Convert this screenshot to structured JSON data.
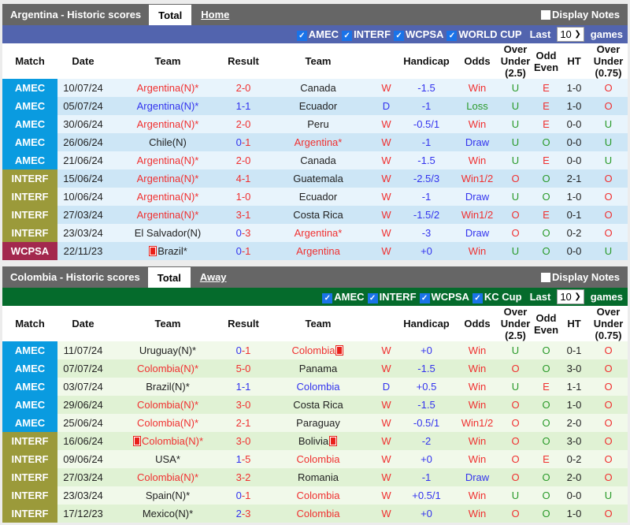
{
  "colors": {
    "argentina_filter": "#5264ae",
    "colombia_filter": "#056b2c",
    "AMEC": "#0a9be0",
    "INTERF": "#9b9a3a",
    "WCPSA": "#a3284e"
  },
  "columns": [
    "Match",
    "Date",
    "Team",
    "Result",
    "Team",
    "",
    "Handicap",
    "Odds",
    "Over Under (2.5)",
    "Odd Even",
    "HT",
    "Over Under (0.75)"
  ],
  "panels": [
    {
      "key": "arg",
      "title": "Argentina - Historic scores",
      "tab_active": "Total",
      "tab_link": "Home",
      "notes": "Display Notes",
      "filters": [
        "AMEC",
        "INTERF",
        "WCPSA",
        "WORLD CUP"
      ],
      "last_label": "Last",
      "last_value": "10",
      "games_label": "games",
      "rows": [
        {
          "m": "AMEC",
          "d": "10/07/24",
          "h": {
            "n": "Argentina(N)*",
            "c": "red"
          },
          "s": "2-0",
          "a": {
            "n": "Canada",
            "c": "black"
          },
          "side": "h",
          "r": "W",
          "hc": "-1.5",
          "o": "Win",
          "ou": "U",
          "oe": "E",
          "ht": "1-0",
          "ou2": "O"
        },
        {
          "m": "AMEC",
          "d": "05/07/24",
          "h": {
            "n": "Argentina(N)*",
            "c": "blue"
          },
          "s": "1-1",
          "a": {
            "n": "Ecuador",
            "c": "black"
          },
          "side": "h",
          "r": "D",
          "hc": "-1",
          "o": "Loss",
          "ou": "U",
          "oe": "E",
          "ht": "1-0",
          "ou2": "O"
        },
        {
          "m": "AMEC",
          "d": "30/06/24",
          "h": {
            "n": "Argentina(N)*",
            "c": "red"
          },
          "s": "2-0",
          "a": {
            "n": "Peru",
            "c": "black"
          },
          "side": "h",
          "r": "W",
          "hc": "-0.5/1",
          "o": "Win",
          "ou": "U",
          "oe": "E",
          "ht": "0-0",
          "ou2": "U"
        },
        {
          "m": "AMEC",
          "d": "26/06/24",
          "h": {
            "n": "Chile(N)",
            "c": "black"
          },
          "s": "0-1",
          "a": {
            "n": "Argentina*",
            "c": "red"
          },
          "side": "a",
          "r": "W",
          "hc": "-1",
          "o": "Draw",
          "ou": "U",
          "oe": "O",
          "ht": "0-0",
          "ou2": "U"
        },
        {
          "m": "AMEC",
          "d": "21/06/24",
          "h": {
            "n": "Argentina(N)*",
            "c": "red"
          },
          "s": "2-0",
          "a": {
            "n": "Canada",
            "c": "black"
          },
          "side": "h",
          "r": "W",
          "hc": "-1.5",
          "o": "Win",
          "ou": "U",
          "oe": "E",
          "ht": "0-0",
          "ou2": "U"
        },
        {
          "m": "INTERF",
          "d": "15/06/24",
          "h": {
            "n": "Argentina(N)*",
            "c": "red"
          },
          "s": "4-1",
          "a": {
            "n": "Guatemala",
            "c": "black"
          },
          "side": "h",
          "r": "W",
          "hc": "-2.5/3",
          "o": "Win1/2",
          "ou": "O",
          "oe": "O",
          "ht": "2-1",
          "ou2": "O"
        },
        {
          "m": "INTERF",
          "d": "10/06/24",
          "h": {
            "n": "Argentina(N)*",
            "c": "red"
          },
          "s": "1-0",
          "a": {
            "n": "Ecuador",
            "c": "black"
          },
          "side": "h",
          "r": "W",
          "hc": "-1",
          "o": "Draw",
          "ou": "U",
          "oe": "O",
          "ht": "1-0",
          "ou2": "O"
        },
        {
          "m": "INTERF",
          "d": "27/03/24",
          "h": {
            "n": "Argentina(N)*",
            "c": "red"
          },
          "s": "3-1",
          "a": {
            "n": "Costa Rica",
            "c": "black"
          },
          "side": "h",
          "r": "W",
          "hc": "-1.5/2",
          "o": "Win1/2",
          "ou": "O",
          "oe": "E",
          "ht": "0-1",
          "ou2": "O"
        },
        {
          "m": "INTERF",
          "d": "23/03/24",
          "h": {
            "n": "El Salvador(N)",
            "c": "black"
          },
          "s": "0-3",
          "a": {
            "n": "Argentina*",
            "c": "red"
          },
          "side": "a",
          "r": "W",
          "hc": "-3",
          "o": "Draw",
          "ou": "O",
          "oe": "O",
          "ht": "0-2",
          "ou2": "O"
        },
        {
          "m": "WCPSA",
          "d": "22/11/23",
          "h": {
            "n": "Brazil*",
            "c": "black",
            "card": "before"
          },
          "s": "0-1",
          "a": {
            "n": "Argentina",
            "c": "red"
          },
          "side": "a",
          "r": "W",
          "hc": "+0",
          "o": "Win",
          "ou": "U",
          "oe": "O",
          "ht": "0-0",
          "ou2": "U"
        }
      ]
    },
    {
      "key": "col",
      "title": "Colombia - Historic scores",
      "tab_active": "Total",
      "tab_link": "Away",
      "notes": "Display Notes",
      "filters": [
        "AMEC",
        "INTERF",
        "WCPSA",
        "KC Cup"
      ],
      "last_label": "Last",
      "last_value": "10",
      "games_label": "games",
      "rows": [
        {
          "m": "AMEC",
          "d": "11/07/24",
          "h": {
            "n": "Uruguay(N)*",
            "c": "black"
          },
          "s": "0-1",
          "a": {
            "n": "Colombia",
            "c": "red",
            "card": "after"
          },
          "side": "a",
          "r": "W",
          "hc": "+0",
          "o": "Win",
          "ou": "U",
          "oe": "O",
          "ht": "0-1",
          "ou2": "O"
        },
        {
          "m": "AMEC",
          "d": "07/07/24",
          "h": {
            "n": "Colombia(N)*",
            "c": "red"
          },
          "s": "5-0",
          "a": {
            "n": "Panama",
            "c": "black"
          },
          "side": "h",
          "r": "W",
          "hc": "-1.5",
          "o": "Win",
          "ou": "O",
          "oe": "O",
          "ht": "3-0",
          "ou2": "O"
        },
        {
          "m": "AMEC",
          "d": "03/07/24",
          "h": {
            "n": "Brazil(N)*",
            "c": "black"
          },
          "s": "1-1",
          "a": {
            "n": "Colombia",
            "c": "blue"
          },
          "side": "a",
          "r": "D",
          "hc": "+0.5",
          "o": "Win",
          "ou": "U",
          "oe": "E",
          "ht": "1-1",
          "ou2": "O"
        },
        {
          "m": "AMEC",
          "d": "29/06/24",
          "h": {
            "n": "Colombia(N)*",
            "c": "red"
          },
          "s": "3-0",
          "a": {
            "n": "Costa Rica",
            "c": "black"
          },
          "side": "h",
          "r": "W",
          "hc": "-1.5",
          "o": "Win",
          "ou": "O",
          "oe": "O",
          "ht": "1-0",
          "ou2": "O"
        },
        {
          "m": "AMEC",
          "d": "25/06/24",
          "h": {
            "n": "Colombia(N)*",
            "c": "red"
          },
          "s": "2-1",
          "a": {
            "n": "Paraguay",
            "c": "black"
          },
          "side": "h",
          "r": "W",
          "hc": "-0.5/1",
          "o": "Win1/2",
          "ou": "O",
          "oe": "O",
          "ht": "2-0",
          "ou2": "O"
        },
        {
          "m": "INTERF",
          "d": "16/06/24",
          "h": {
            "n": "Colombia(N)*",
            "c": "red",
            "card": "before"
          },
          "s": "3-0",
          "a": {
            "n": "Bolivia",
            "c": "black",
            "card": "after"
          },
          "side": "h",
          "r": "W",
          "hc": "-2",
          "o": "Win",
          "ou": "O",
          "oe": "O",
          "ht": "3-0",
          "ou2": "O"
        },
        {
          "m": "INTERF",
          "d": "09/06/24",
          "h": {
            "n": "USA*",
            "c": "black"
          },
          "s": "1-5",
          "a": {
            "n": "Colombia",
            "c": "red"
          },
          "side": "a",
          "r": "W",
          "hc": "+0",
          "o": "Win",
          "ou": "O",
          "oe": "E",
          "ht": "0-2",
          "ou2": "O"
        },
        {
          "m": "INTERF",
          "d": "27/03/24",
          "h": {
            "n": "Colombia(N)*",
            "c": "red"
          },
          "s": "3-2",
          "a": {
            "n": "Romania",
            "c": "black"
          },
          "side": "h",
          "r": "W",
          "hc": "-1",
          "o": "Draw",
          "ou": "O",
          "oe": "O",
          "ht": "2-0",
          "ou2": "O"
        },
        {
          "m": "INTERF",
          "d": "23/03/24",
          "h": {
            "n": "Spain(N)*",
            "c": "black"
          },
          "s": "0-1",
          "a": {
            "n": "Colombia",
            "c": "red"
          },
          "side": "a",
          "r": "W",
          "hc": "+0.5/1",
          "o": "Win",
          "ou": "U",
          "oe": "O",
          "ht": "0-0",
          "ou2": "U"
        },
        {
          "m": "INTERF",
          "d": "17/12/23",
          "h": {
            "n": "Mexico(N)*",
            "c": "black"
          },
          "s": "2-3",
          "a": {
            "n": "Colombia",
            "c": "red"
          },
          "side": "a",
          "r": "W",
          "hc": "+0",
          "o": "Win",
          "ou": "O",
          "oe": "O",
          "ht": "1-0",
          "ou2": "O"
        }
      ]
    }
  ]
}
